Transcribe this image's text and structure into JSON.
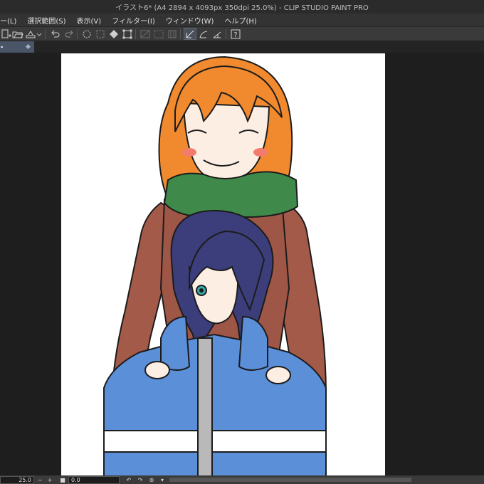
{
  "window": {
    "title": "イラスト6* (A4 2894 x 4093px 350dpi 25.0%)  - CLIP STUDIO PAINT PRO"
  },
  "menu": [
    {
      "label": "ー(L)"
    },
    {
      "label": "選択範囲(S)"
    },
    {
      "label": "表示(V)"
    },
    {
      "label": "フィルター(I)"
    },
    {
      "label": "ウィンドウ(W)"
    },
    {
      "label": "ヘルプ(H)"
    }
  ],
  "toolbar": {
    "icons": [
      "new-file-icon",
      "open-folder-icon",
      "save-icon",
      "undo-icon",
      "redo-icon",
      "clear-icon",
      "cut-outside-icon",
      "fill-icon",
      "transform-icon",
      "hide-selection-icon",
      "snap-to-ruler-icon",
      "snap-to-special-ruler-icon",
      "snap-to-grid-icon",
      "help-icon"
    ]
  },
  "status": {
    "zoom": "25.0",
    "rotation": "0.0"
  },
  "colors": {
    "accent": "#4a5568",
    "canvas": "#ffffff",
    "workspace": "#1e1e1e"
  }
}
